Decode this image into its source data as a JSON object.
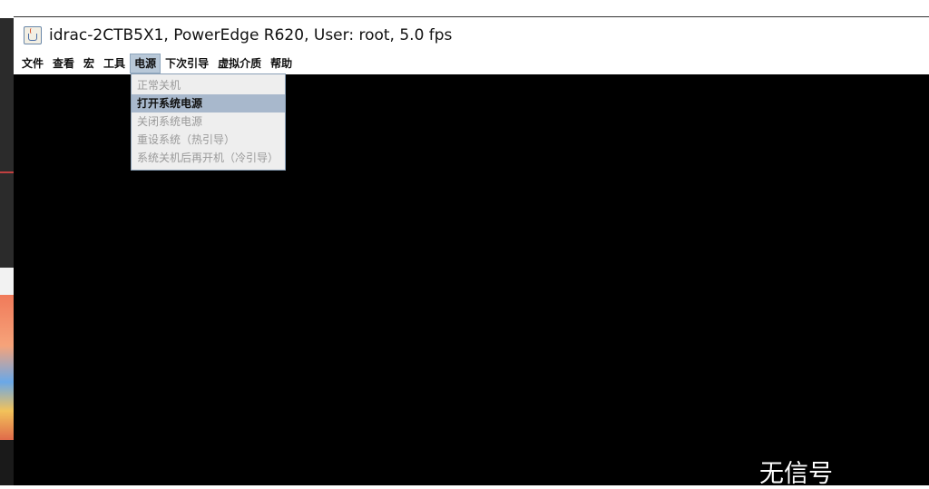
{
  "window": {
    "title": "idrac-2CTB5X1, PowerEdge R620, User: root, 5.0 fps",
    "icon": "java-cup-icon"
  },
  "menubar": {
    "items": [
      {
        "label": "文件"
      },
      {
        "label": "查看"
      },
      {
        "label": "宏"
      },
      {
        "label": "工具"
      },
      {
        "label": "电源",
        "active": true
      },
      {
        "label": "下次引导"
      },
      {
        "label": "虚拟介质"
      },
      {
        "label": "帮助"
      }
    ]
  },
  "power_menu": {
    "items": [
      {
        "label": "正常关机",
        "enabled": false
      },
      {
        "label": "打开系统电源",
        "enabled": true,
        "highlighted": true
      },
      {
        "label": "关闭系统电源",
        "enabled": false
      },
      {
        "label": "重设系统（热引导）",
        "enabled": false
      },
      {
        "label": "系统关机后再开机（冷引导）",
        "enabled": false
      }
    ]
  },
  "console": {
    "status_text": "无信号",
    "background": "#000000"
  },
  "colors": {
    "menu_active_bg": "#b8c8d8",
    "dropdown_highlight": "#a8b8cc",
    "disabled_text": "#9a9a9a"
  }
}
